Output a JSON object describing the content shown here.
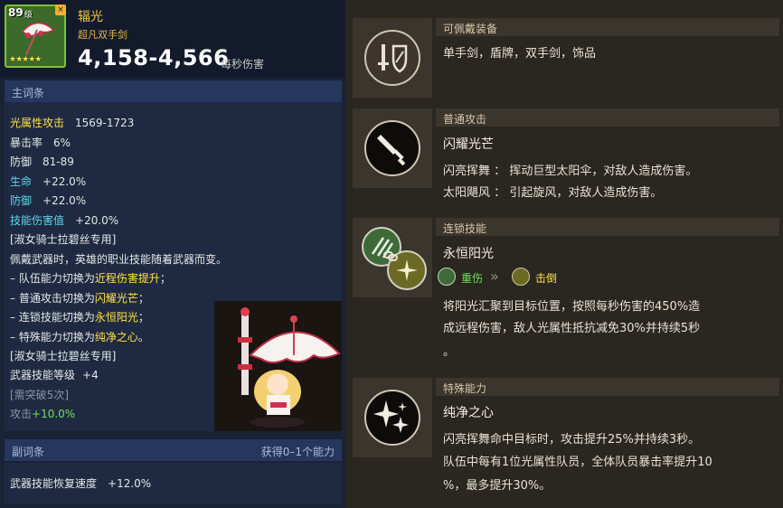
{
  "item": {
    "level": "89",
    "level_unit": "级",
    "stars": "★★★★★",
    "name": "辐光",
    "type": "超凡双手剑",
    "dps": "4,158-4,566",
    "dps_unit": "每秒伤害"
  },
  "main_section": {
    "title": "主词条",
    "stats": [
      {
        "key": "光属性攻击",
        "value": "1569-1723"
      },
      {
        "key": "暴击率",
        "value": "6%"
      },
      {
        "key": "防御",
        "value": "81-89"
      },
      {
        "key": "生命",
        "value": "+22.0%"
      },
      {
        "key": "防御",
        "value": "+22.0%"
      },
      {
        "key": "技能伤害值",
        "value": "+20.0%"
      }
    ],
    "exclusive_header": "[淑女骑士拉碧丝专用]",
    "exclusive_desc": "佩戴武器时，英雄的职业技能随着武器而变。",
    "changes": [
      {
        "prefix": "– 队伍能力切换为",
        "highlight": "近程伤害提升",
        "suffix": "；"
      },
      {
        "prefix": "– 普通攻击切换为",
        "highlight": "闪耀光芒",
        "suffix": "；"
      },
      {
        "prefix": "– 连锁技能切换为",
        "highlight": "永恒阳光",
        "suffix": "；"
      },
      {
        "prefix": "– 特殊能力切换为",
        "highlight": "纯净之心",
        "suffix": "。"
      }
    ],
    "exclusive_header2": "[淑女骑士拉碧丝专用]",
    "weapon_skill_label": "武器技能等级",
    "weapon_skill_value": "+4",
    "limit_break": "[需突破5次]",
    "attack_label": "攻击",
    "attack_value": "+10.0%"
  },
  "sub_section": {
    "title": "副词条",
    "right_label": "获得0–1个能力",
    "stat_key": "武器技能恢复速度",
    "stat_value": "+12.0%"
  },
  "equip": {
    "title": "可佩戴装备",
    "value": "单手剑，盾牌，双手剑，饰品"
  },
  "normal_attack": {
    "title": "普通攻击",
    "name": "闪耀光芒",
    "line1_label": "闪亮挥舞",
    "line1_sep": "：",
    "line1_desc": "挥动巨型太阳伞，对敌人造成伤害。",
    "line2_label": "太阳飓风",
    "line2_sep": "：",
    "line2_desc": "引起旋风，对敌人造成伤害。"
  },
  "chain_skill": {
    "title": "连锁技能",
    "name": "永恒阳光",
    "from_state": "重伤",
    "to_state": "击倒",
    "arrow": "»",
    "desc1": "将阳光汇聚到目标位置，按照每秒伤害的450%造",
    "desc2": "成远程伤害，敌人光属性抵抗减免30%并持续5秒",
    "desc3": "。"
  },
  "special": {
    "title": "特殊能力",
    "name": "纯净之心",
    "desc1": "闪亮挥舞命中目标时，攻击提升25%并持续3秒。",
    "desc2": "队伍中每有1位光属性队员，全体队员暴击率提升10",
    "desc3": "%，最多提升30%。"
  },
  "colors": {
    "left_bg": "#1a2236",
    "right_bg": "#2a2620",
    "gold": "#f3c640",
    "green": "#6fe05a",
    "cyan": "#5fd4e8",
    "yellow": "#ffe14a"
  }
}
